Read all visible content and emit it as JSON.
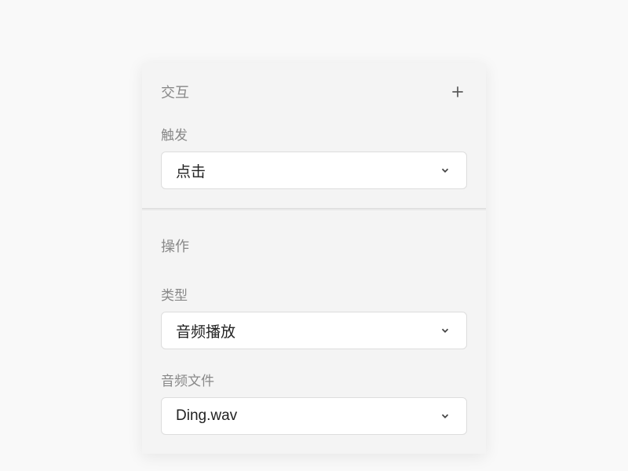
{
  "interaction": {
    "title": "交互",
    "trigger": {
      "label": "触发",
      "value": "点击"
    }
  },
  "action": {
    "title": "操作",
    "type": {
      "label": "类型",
      "value": "音频播放"
    },
    "audioFile": {
      "label": "音频文件",
      "value": "Ding.wav"
    }
  }
}
